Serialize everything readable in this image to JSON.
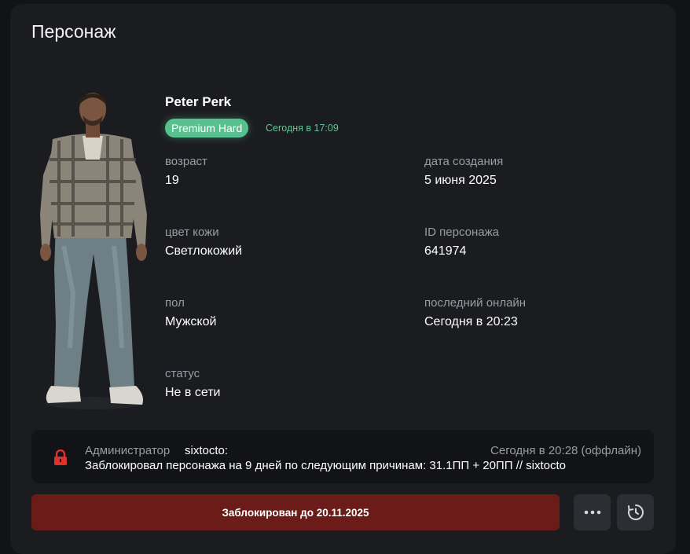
{
  "section_title": "Персонаж",
  "character": {
    "name": "Peter Perk",
    "premium_label": "Premium Hard",
    "premium_time": "Сегодня в 17:09"
  },
  "fields": {
    "age": {
      "label": "возраст",
      "value": "19"
    },
    "created": {
      "label": "дата создания",
      "value": "5 июня 2025"
    },
    "skin": {
      "label": "цвет кожи",
      "value": "Светлокожий"
    },
    "id": {
      "label": "ID персонажа",
      "value": "641974"
    },
    "gender": {
      "label": "пол",
      "value": "Мужской"
    },
    "last_online": {
      "label": "последний онлайн",
      "value": "Сегодня в 20:23"
    },
    "status": {
      "label": "статус",
      "value": "Не в сети"
    }
  },
  "ban": {
    "admin_prefix": "Администратор",
    "admin_name": "sixtocto:",
    "time": "Сегодня в 20:28 (оффлайн)",
    "reason": "Заблокировал персонажа на 9 дней по следующим причинам: 31.1ПП + 20ПП // sixtocto",
    "button_label": "Заблокирован до 20.11.2025"
  },
  "icons": {
    "lock": "lock-icon",
    "more": "more-icon",
    "history": "history-icon"
  },
  "colors": {
    "premium": "#58c08f",
    "banned": "#6b1c19",
    "lock": "#e0322c"
  }
}
